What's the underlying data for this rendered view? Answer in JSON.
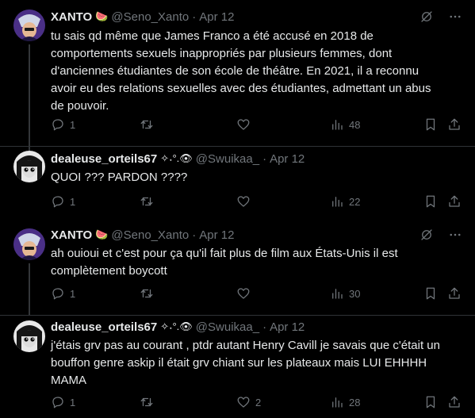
{
  "tweets": [
    {
      "name": "XANTO",
      "emoji": "🍉",
      "handle": "@Seno_Xanto",
      "dot": "·",
      "date": "Apr 12",
      "text": "tu sais qd même que James Franco a été accusé en 2018 de comportements sexuels inappropriés par plusieurs femmes, dont d'anciennes étudiantes de son école de théâtre. En 2021, il a reconnu avoir eu des relations sexuelles avec des étudiantes, admettant un abus de pouvoir.",
      "replies": "1",
      "retweets": "",
      "likes": "",
      "views": "48"
    },
    {
      "name": "dealeuse_orteils67",
      "emoji": "✧˖°.👁",
      "handle": "@Swuikaa_",
      "dot": "·",
      "date": "Apr 12",
      "text": "QUOI ??? PARDON ????",
      "replies": "1",
      "retweets": "",
      "likes": "",
      "views": "22"
    },
    {
      "name": "XANTO",
      "emoji": "🍉",
      "handle": "@Seno_Xanto",
      "dot": "·",
      "date": "Apr 12",
      "text": "ah ouioui et c'est pour ça qu'il fait plus de film aux États-Unis il est complètement boycott",
      "replies": "1",
      "retweets": "",
      "likes": "",
      "views": "30"
    },
    {
      "name": "dealeuse_orteils67",
      "emoji": "✧˖°.👁",
      "handle": "@Swuikaa_",
      "dot": "·",
      "date": "Apr 12",
      "text": "j'étais grv pas au courant , ptdr autant Henry Cavill je savais que c'était un bouffon genre askip il était grv chiant sur les plateaux mais LUI EHHHH MAMA",
      "replies": "1",
      "retweets": "",
      "likes": "2",
      "views": "28"
    }
  ],
  "colors": {
    "background": "#000000",
    "text": "#e7e9ea",
    "muted": "#71767b",
    "separator": "#2f3336"
  },
  "icons": [
    "grok-icon",
    "more-icon",
    "reply-icon",
    "retweet-icon",
    "like-icon",
    "views-icon",
    "bookmark-icon",
    "share-icon"
  ]
}
